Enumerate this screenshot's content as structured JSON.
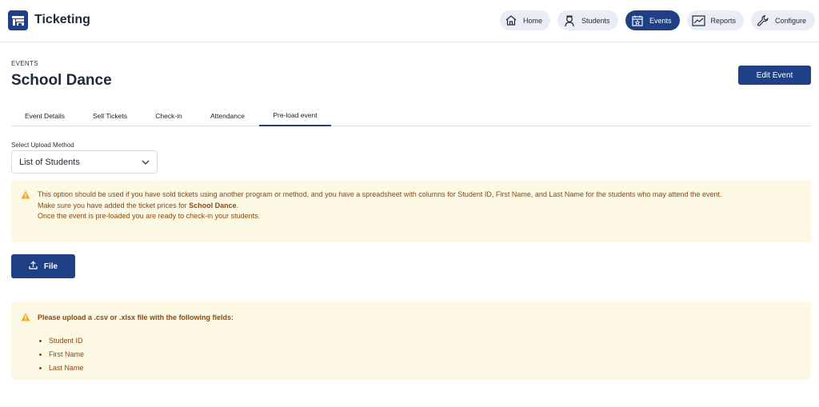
{
  "header": {
    "app_title": "Ticketing",
    "nav": [
      {
        "label": "Home",
        "icon": "home-icon"
      },
      {
        "label": "Students",
        "icon": "student-icon"
      },
      {
        "label": "Events",
        "icon": "calendar-star-icon",
        "active": true
      },
      {
        "label": "Reports",
        "icon": "chart-line-icon"
      },
      {
        "label": "Configure",
        "icon": "wrench-icon"
      }
    ]
  },
  "page": {
    "eyebrow": "EVENTS",
    "title": "School Dance",
    "edit_button": "Edit Event"
  },
  "tabs": [
    {
      "label": "Event Details"
    },
    {
      "label": "Sell Tickets"
    },
    {
      "label": "Check-in"
    },
    {
      "label": "Attendance"
    },
    {
      "label": "Pre-load event",
      "active": true
    }
  ],
  "upload": {
    "label": "Select Upload Method",
    "selected": "List of Students"
  },
  "info_alert": {
    "line1": "This option should be used if you have sold tickets using another program or method, and you have a spreadsheet with columns for Student ID, First Name, and Last Name for the students who may attend the event.",
    "line2_prefix": "Make sure you have added the ticket prices for ",
    "line2_event": "School Dance",
    "line2_suffix": ".",
    "line3": "Once the event is pre-loaded you are ready to check-in your students."
  },
  "file_button": "File",
  "fields_alert": {
    "title": "Please upload a .csv or .xlsx file with the following fields:",
    "fields": [
      "Student ID",
      "First Name",
      "Last Name"
    ]
  },
  "colors": {
    "brand": "#1f3f86",
    "nav_bg": "#e8edf6",
    "alert_bg": "#fdf8e4",
    "alert_text": "#8a4a12",
    "warning_icon": "#e8b020"
  }
}
